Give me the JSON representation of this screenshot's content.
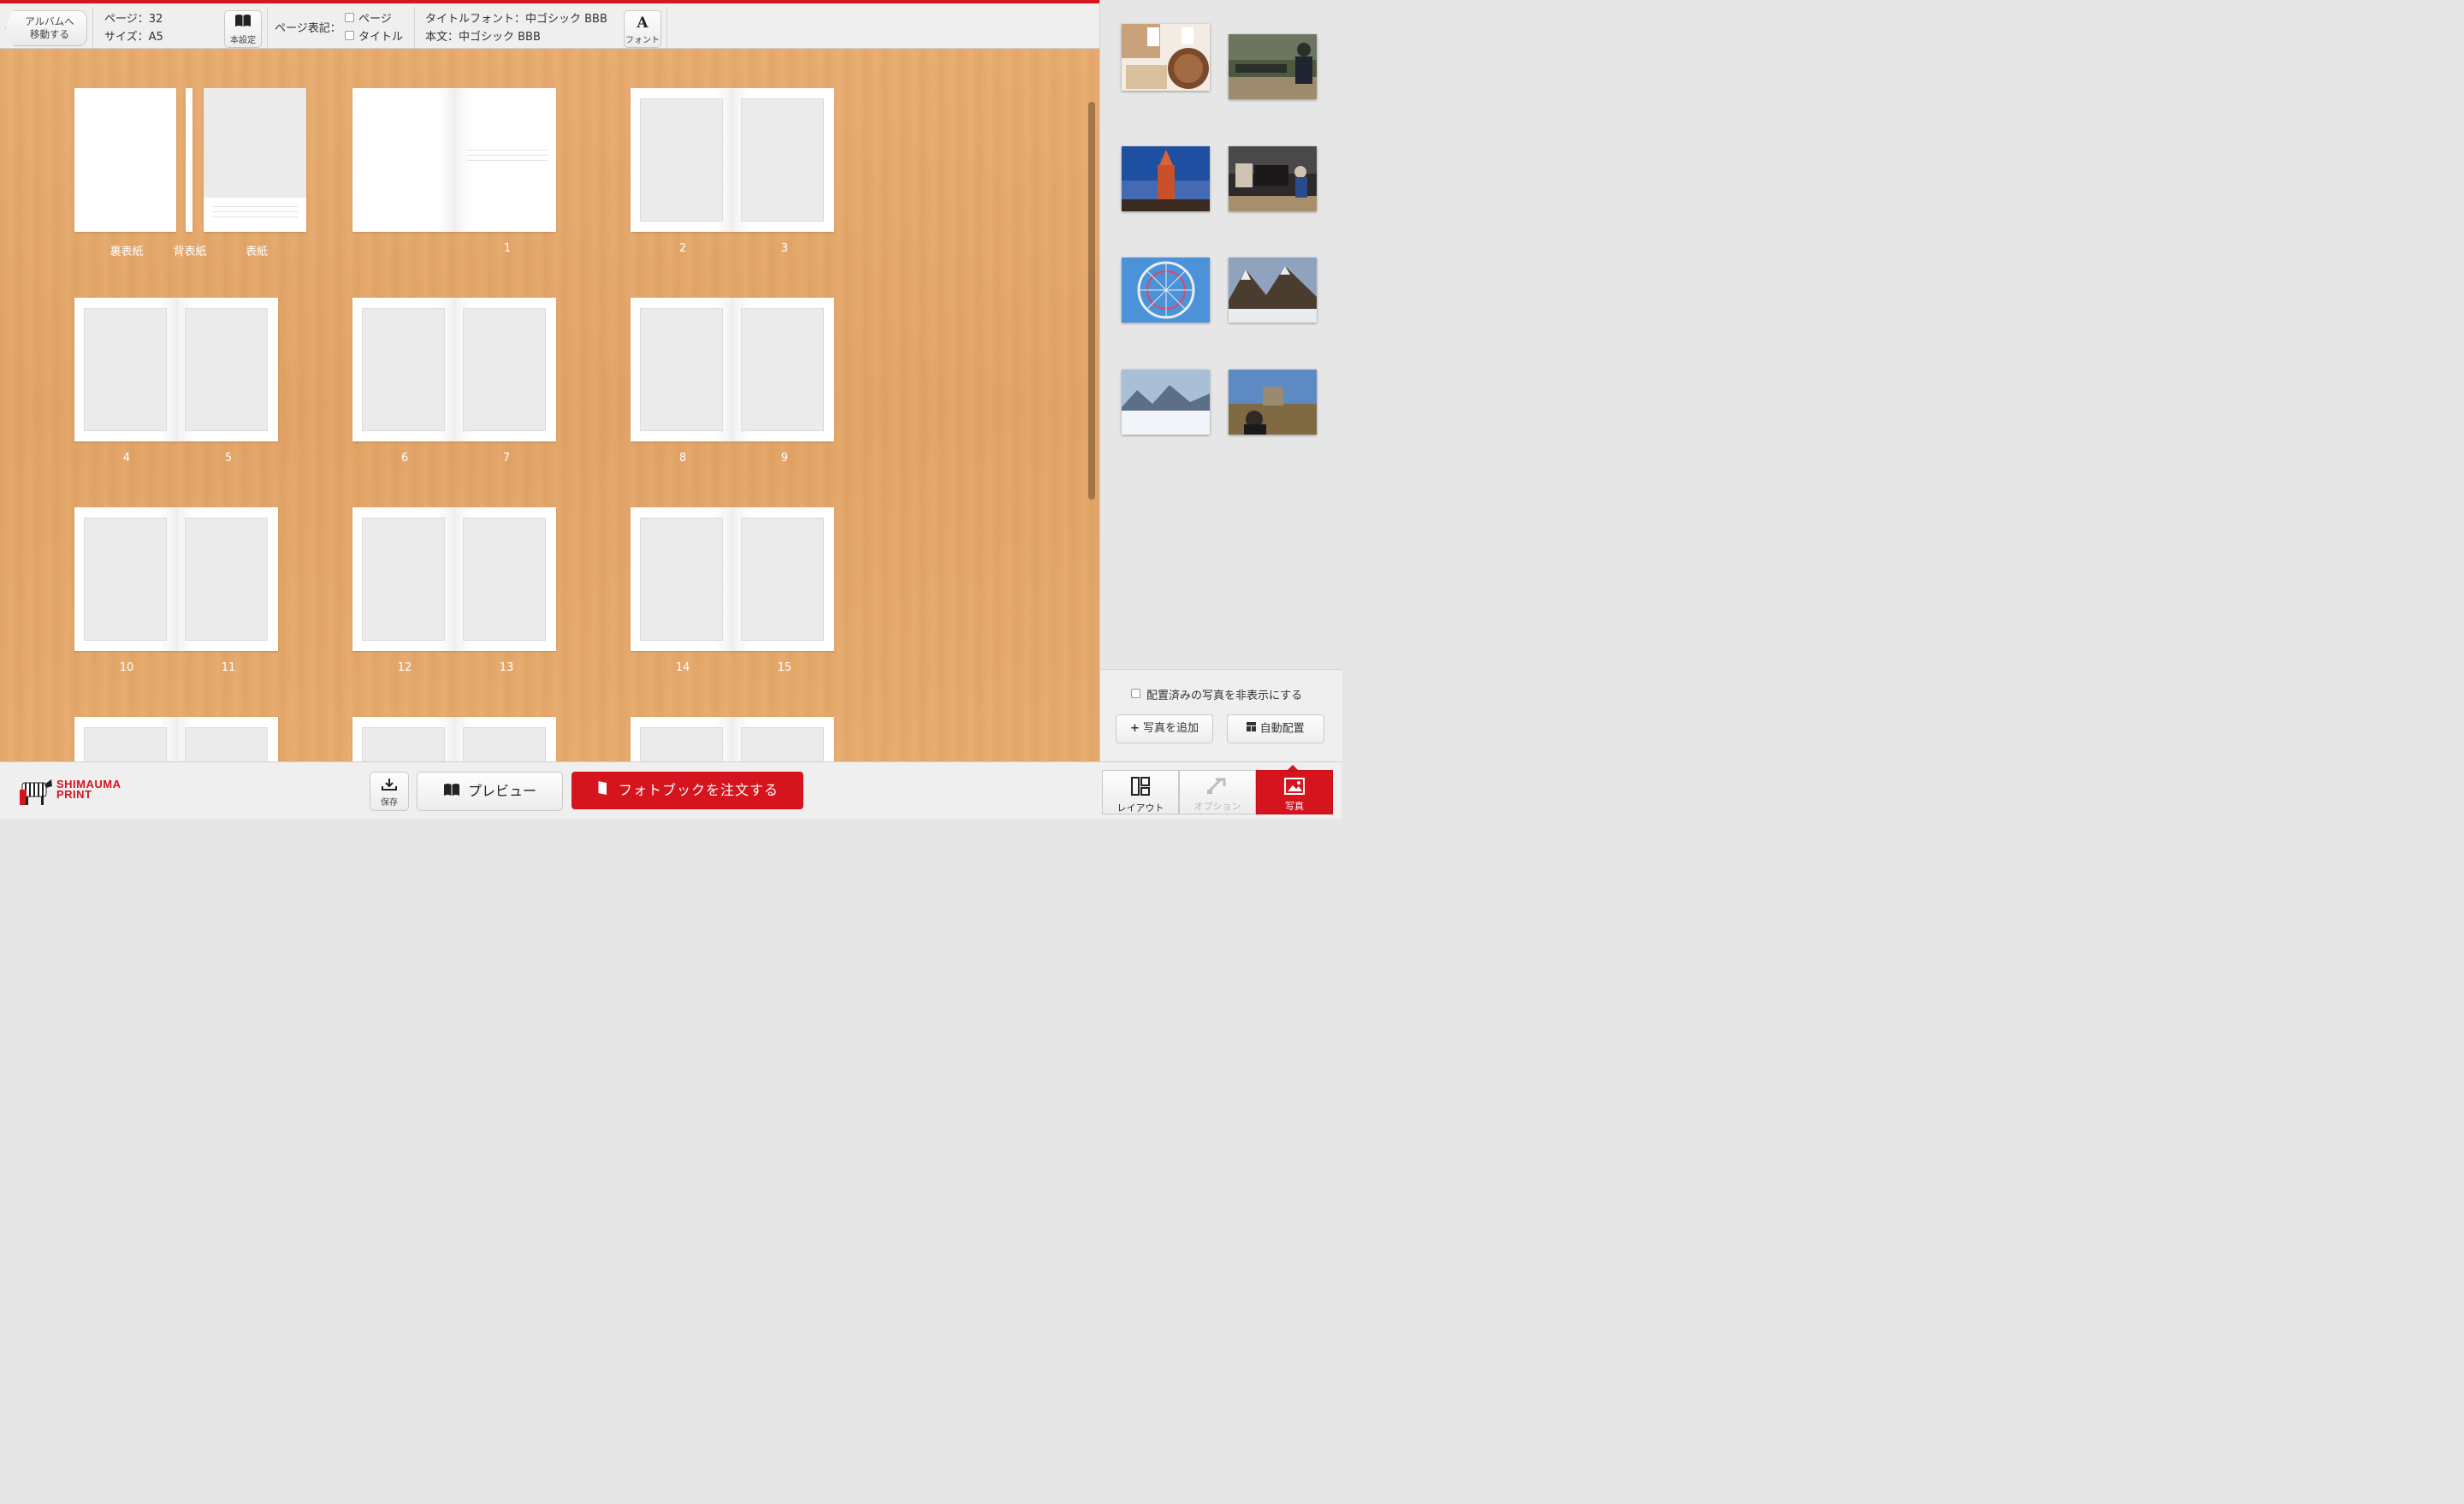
{
  "toolbar": {
    "back_line1": "アルバムへ",
    "back_line2": "移動する",
    "pages": "ページ：32",
    "size": "サイズ：A5",
    "book_settings": "本設定",
    "page_notation_label": "ページ表記：",
    "chk_page": "ページ",
    "chk_title": "タイトル",
    "title_font": "タイトルフォント：中ゴシック BBB",
    "body_font": "本文：中ゴシック BBB",
    "font_btn": "フォント",
    "font_glyph": "A"
  },
  "cover": {
    "back_cover": "裏表紙",
    "spine": "背表紙",
    "front_cover": "表紙"
  },
  "spreads": [
    {
      "left": "",
      "right": "1"
    },
    {
      "left": "2",
      "right": "3"
    },
    {
      "left": "4",
      "right": "5"
    },
    {
      "left": "6",
      "right": "7"
    },
    {
      "left": "8",
      "right": "9"
    },
    {
      "left": "10",
      "right": "11"
    },
    {
      "left": "12",
      "right": "13"
    },
    {
      "left": "14",
      "right": "15"
    }
  ],
  "photos": [
    {
      "name": "photo-food-market",
      "colors": [
        "#f3ece2",
        "#7a4a2c",
        "#c7a27a"
      ]
    },
    {
      "name": "photo-park-bench",
      "colors": [
        "#4e5a3f",
        "#2a2f2a",
        "#9d8b6e"
      ]
    },
    {
      "name": "photo-red-tower",
      "colors": [
        "#1f4fa0",
        "#c8502a",
        "#6b86c8"
      ]
    },
    {
      "name": "photo-horse-carriage",
      "colors": [
        "#2c2a2a",
        "#a88e6d",
        "#cfc3b2"
      ]
    },
    {
      "name": "photo-ferris-wheel",
      "colors": [
        "#4b92d9",
        "#e9eef5",
        "#2b64b1"
      ]
    },
    {
      "name": "photo-mountain-village",
      "colors": [
        "#8fa3bf",
        "#e8ecef",
        "#4a3c2f"
      ]
    },
    {
      "name": "photo-snowy-mountains",
      "colors": [
        "#a9bfd8",
        "#f1f4f8",
        "#5d6f88"
      ]
    },
    {
      "name": "photo-castle-selfie",
      "colors": [
        "#5d8ac2",
        "#806a44",
        "#2e2a24"
      ]
    }
  ],
  "side": {
    "hide_placed": "配置済みの写真を非表示にする",
    "add_photos": "写真を追加",
    "auto_place": "自動配置"
  },
  "footer": {
    "logo_line1": "SHIMAUMA",
    "logo_line2": "PRINT",
    "save": "保存",
    "preview": "プレビュー",
    "order": "フォトブックを注文する",
    "mode_layout": "レイアウト",
    "mode_option": "オプション",
    "mode_photo": "写真"
  },
  "colors": {
    "accent": "#d6141e",
    "wood": "#e4a86b"
  }
}
